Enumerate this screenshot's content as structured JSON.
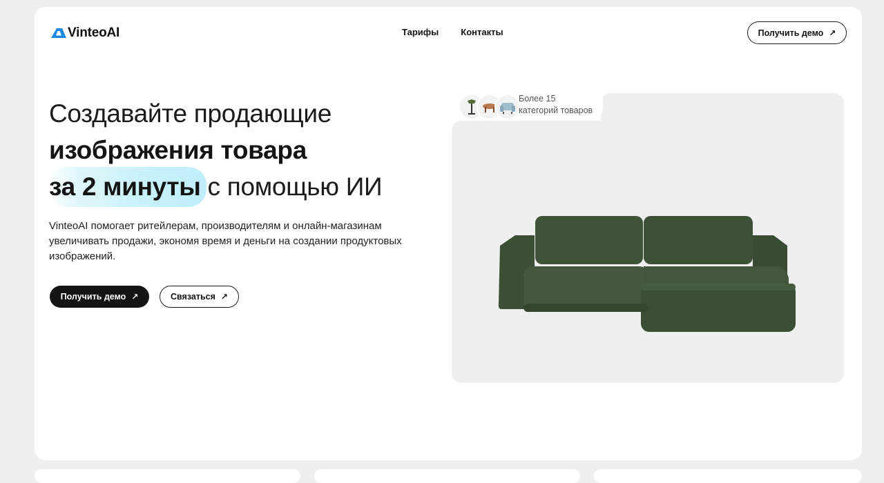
{
  "brand": {
    "name": "VinteoAI",
    "color": "#1e88e5"
  },
  "nav": {
    "items": [
      "Тарифы",
      "Контакты"
    ]
  },
  "header_cta": {
    "label": "Получить демо",
    "icon": "arrow-up-right-icon"
  },
  "hero": {
    "line1": "Создавайте продающие",
    "line2": "изображения товара",
    "line3_highlight": "за 2 минуты",
    "line3_rest": "с помощью ИИ",
    "description": "VinteoAI помогает ритейлерам, производителям и онлайн-магазинам увеличивать продажи, экономя время и деньги на создании продуктовых изображений.",
    "primary_cta": "Получить демо",
    "secondary_cta": "Связаться"
  },
  "badge": {
    "line1": "Более 15",
    "line2": "категорий товаров"
  },
  "product": {
    "name": "green-corner-sofa",
    "color": "#3d5136"
  }
}
